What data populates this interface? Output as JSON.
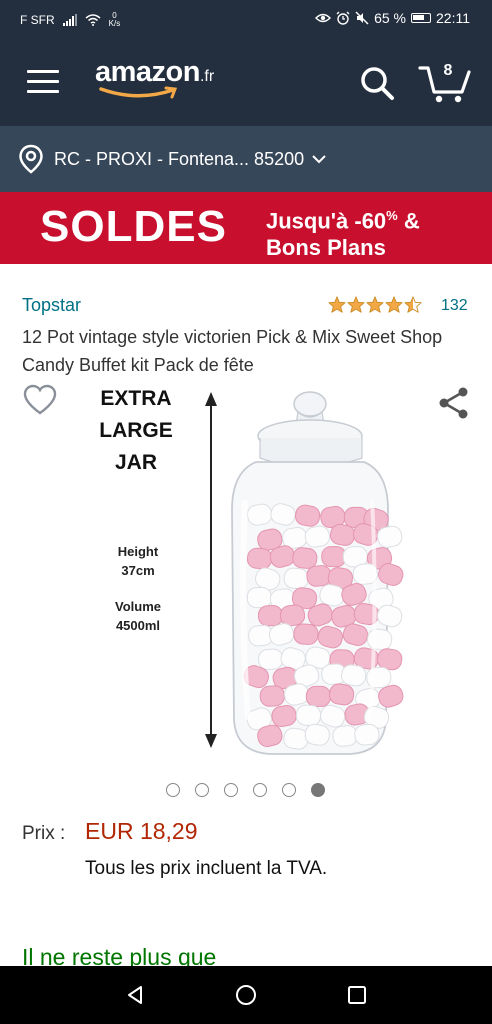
{
  "status_bar": {
    "carrier": "F SFR",
    "speed_value": "0",
    "speed_unit": "K/s",
    "battery": "65 %",
    "time": "22:11"
  },
  "header": {
    "logo": "amazon",
    "logo_tld": ".fr",
    "cart_count": "8"
  },
  "location": {
    "text": "RC - PROXI - Fontena... 85200"
  },
  "banner": {
    "title": "SOLDES",
    "line1_prefix": "Jusqu'à -60",
    "line1_sup": "%",
    "line1_suffix": " &",
    "line2": "Bons Plans"
  },
  "product": {
    "brand": "Topstar",
    "rating": 4.5,
    "rating_count": "132",
    "title": "12 Pot vintage style victorien Pick & Mix Sweet Shop Candy Buffet kit Pack de fête",
    "image_text": {
      "line1": "EXTRA",
      "line2": "LARGE",
      "line3": "JAR",
      "height_label": "Height",
      "height_value": "37cm",
      "volume_label": "Volume",
      "volume_value": "4500ml"
    },
    "image_count": 6,
    "active_image": 6,
    "price_label": "Prix :",
    "price": "EUR 18,29",
    "vat_note": "Tous les prix incluent la TVA.",
    "stock_note": "Il ne reste plus que"
  },
  "colors": {
    "header_bg": "#232f3e",
    "location_bg": "#37475a",
    "banner_bg": "#c8102e",
    "link": "#007185",
    "price": "#b12704",
    "star": "#f3a847",
    "stock": "#007600"
  }
}
